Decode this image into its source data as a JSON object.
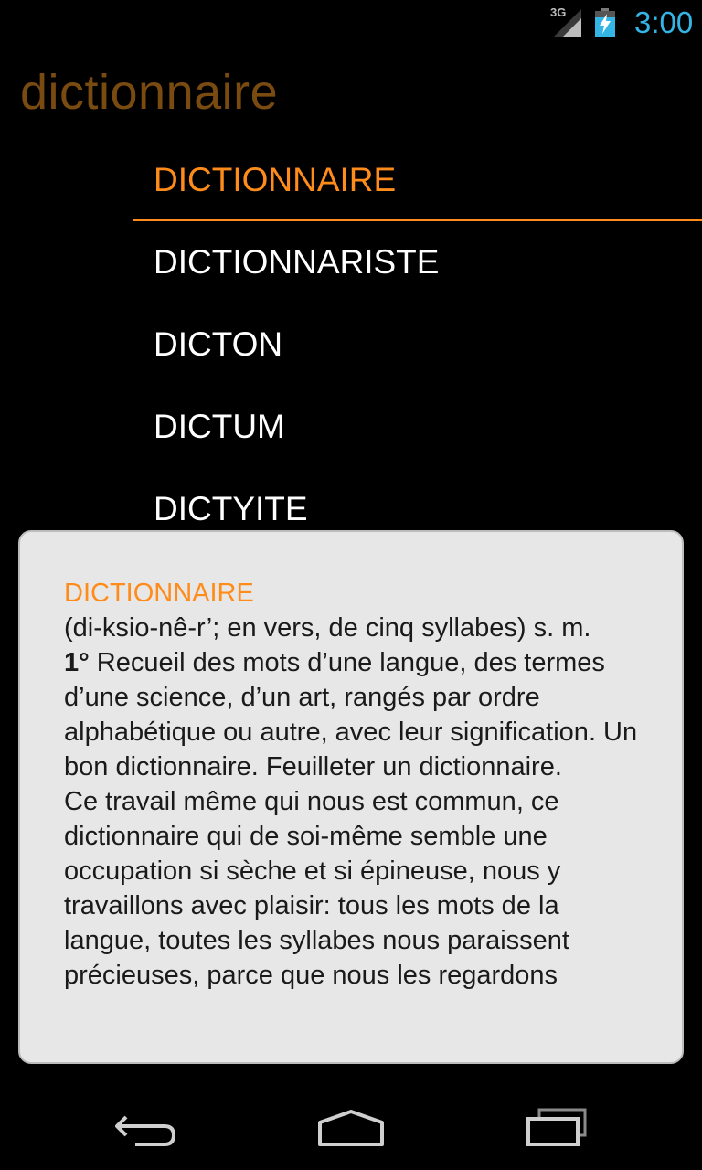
{
  "status_bar": {
    "network": "3G",
    "time": "3:00",
    "icons": [
      "signal-icon",
      "battery-charging-icon"
    ]
  },
  "app": {
    "title": "dictionnaire"
  },
  "word_list": {
    "items": [
      {
        "label": "DICTIONNAIRE",
        "selected": true
      },
      {
        "label": "DICTIONNARISTE",
        "selected": false
      },
      {
        "label": "DICTON",
        "selected": false
      },
      {
        "label": "DICTUM",
        "selected": false
      },
      {
        "label": "DICTYITE",
        "selected": false
      }
    ]
  },
  "definition": {
    "headword": "DICTIONNAIRE",
    "pronunciation": "(di-ksio-nê-r’; en vers, de cinq syllabes) s. m.",
    "sense_number": "1°",
    "sense_text": " Recueil des mots d’une langue, des termes d’une science, d’un art, rangés par ordre alphabétique ou autre, avec leur signification. Un bon dictionnaire. Feuilleter un dictionnaire.",
    "quote": "Ce travail même qui nous est commun, ce dictionnaire qui de soi-même semble une occupation si sèche et si épineuse, nous y travaillons avec plaisir: tous les mots de la langue, toutes les syllabes nous paraissent précieuses, parce que nous les regardons"
  },
  "colors": {
    "accent": "#ff8c1a",
    "title": "#7a4b10",
    "time": "#33b5e5",
    "card_background": "#e7e7e7"
  },
  "nav_bar": {
    "icons": [
      "back-icon",
      "home-icon",
      "recent-apps-icon"
    ]
  }
}
